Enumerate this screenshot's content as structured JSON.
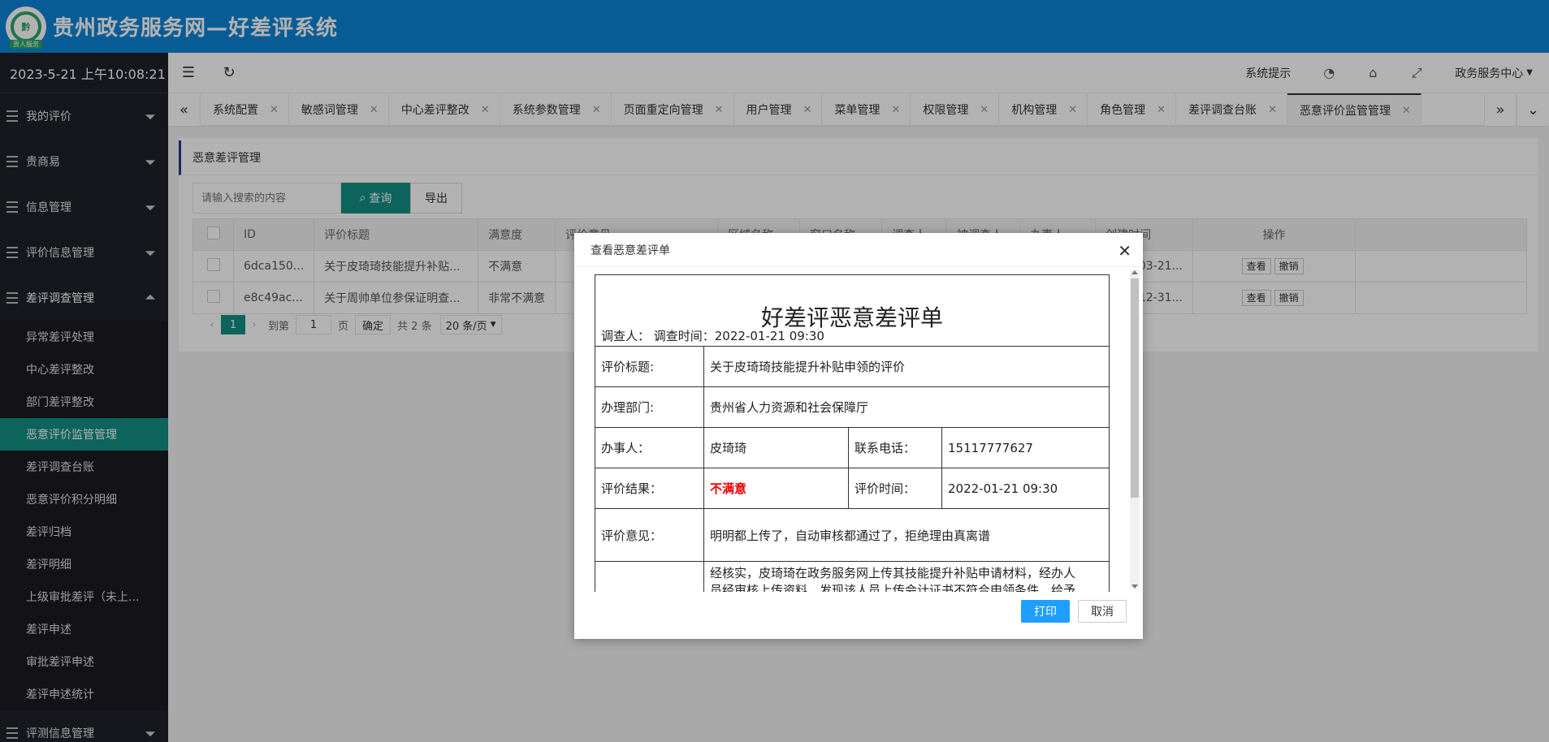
{
  "header": {
    "app_title": "贵州政务服务网—好差评系统",
    "logo_text": "黔",
    "logo_tag": "贵人服务"
  },
  "sidebar": {
    "datetime": "2023-5-21 上午10:08:21",
    "groups": [
      {
        "label": "我的评价"
      },
      {
        "label": "贵商易"
      },
      {
        "label": "信息管理"
      },
      {
        "label": "评价信息管理"
      },
      {
        "label": "差评调查管理"
      }
    ],
    "sub_items": [
      {
        "label": "异常差评处理"
      },
      {
        "label": "中心差评整改"
      },
      {
        "label": "部门差评整改"
      },
      {
        "label": "恶意评价监管管理"
      },
      {
        "label": "差评调查台账"
      },
      {
        "label": "恶意评价积分明细"
      },
      {
        "label": "差评归档"
      },
      {
        "label": "差评明细"
      },
      {
        "label": "上级审批差评（未上..."
      },
      {
        "label": "差评申述"
      },
      {
        "label": "审批差评申述"
      },
      {
        "label": "差评申述统计"
      }
    ],
    "bottom_group": "评测信息管理"
  },
  "toolbar": {
    "system_tip": "系统提示",
    "center": "政务服务中心"
  },
  "tabs": [
    {
      "label": "系统配置"
    },
    {
      "label": "敏感词管理"
    },
    {
      "label": "中心差评整改"
    },
    {
      "label": "系统参数管理"
    },
    {
      "label": "页面重定向管理"
    },
    {
      "label": "用户管理"
    },
    {
      "label": "菜单管理"
    },
    {
      "label": "权限管理"
    },
    {
      "label": "机构管理"
    },
    {
      "label": "角色管理"
    },
    {
      "label": "差评调查台账"
    },
    {
      "label": "恶意评价监管管理"
    }
  ],
  "page": {
    "title": "恶意差评管理",
    "search_placeholder": "请输入搜索的内容",
    "query_label": "查询",
    "export_label": "导出"
  },
  "table": {
    "headers": [
      "ID",
      "评价标题",
      "满意度",
      "评价意见",
      "区域名称",
      "窗口名称",
      "调查人",
      "被调查人",
      "办事人",
      "创建时间",
      "操作"
    ],
    "rows": [
      {
        "id": "6dca150...",
        "title": "关于皮琦琦技能提升补贴...",
        "satisfaction": "不满意",
        "created": "2022-03-21..."
      },
      {
        "id": "e8c49ac...",
        "title": "关于周帅单位参保证明查...",
        "satisfaction": "非常不满意",
        "created": "2021-12-31..."
      }
    ],
    "view_label": "查看",
    "revoke_label": "撤销"
  },
  "pager": {
    "current": "1",
    "goto_label": "到第",
    "goto_value": "1",
    "page_unit": "页",
    "confirm": "确定",
    "total": "共 2 条",
    "page_size": "20 条/页"
  },
  "modal": {
    "title": "查看恶意差评单",
    "form_title": "好差评恶意差评单",
    "investigator_line": "调查人：  调查时间：2022-01-21 09:30",
    "eval_title_label": "评价标题:",
    "eval_title_value": "关于皮琦琦技能提升补贴申领的评价",
    "dept_label": "办理部门:",
    "dept_value": "贵州省人力资源和社会保障厅",
    "applicant_label": "办事人：",
    "applicant_value": "皮琦琦",
    "phone_label": "联系电话：",
    "phone_value": "15117777627",
    "result_label": "评价结果：",
    "result_value": "不满意",
    "eval_time_label": "评价时间：",
    "eval_time_value": "2022-01-21 09:30",
    "opinion_label": "评价意见：",
    "opinion_value": "明明都上传了，自动审核都通过了，拒绝理由真离谱",
    "finding_line1": "经核实，皮琦琦在政务服务网上传其技能提升补贴申请材料，经办人",
    "finding_line2": "员经审核上传资料，发现该人员上传会计证书不符合申领条件，给予",
    "print_label": "打印",
    "cancel_label": "取消"
  },
  "colors": {
    "header_blue": "#0b84d6",
    "sidebar_bg": "#20222a",
    "accent_teal": "#149085",
    "print_blue": "#1e9fff"
  }
}
